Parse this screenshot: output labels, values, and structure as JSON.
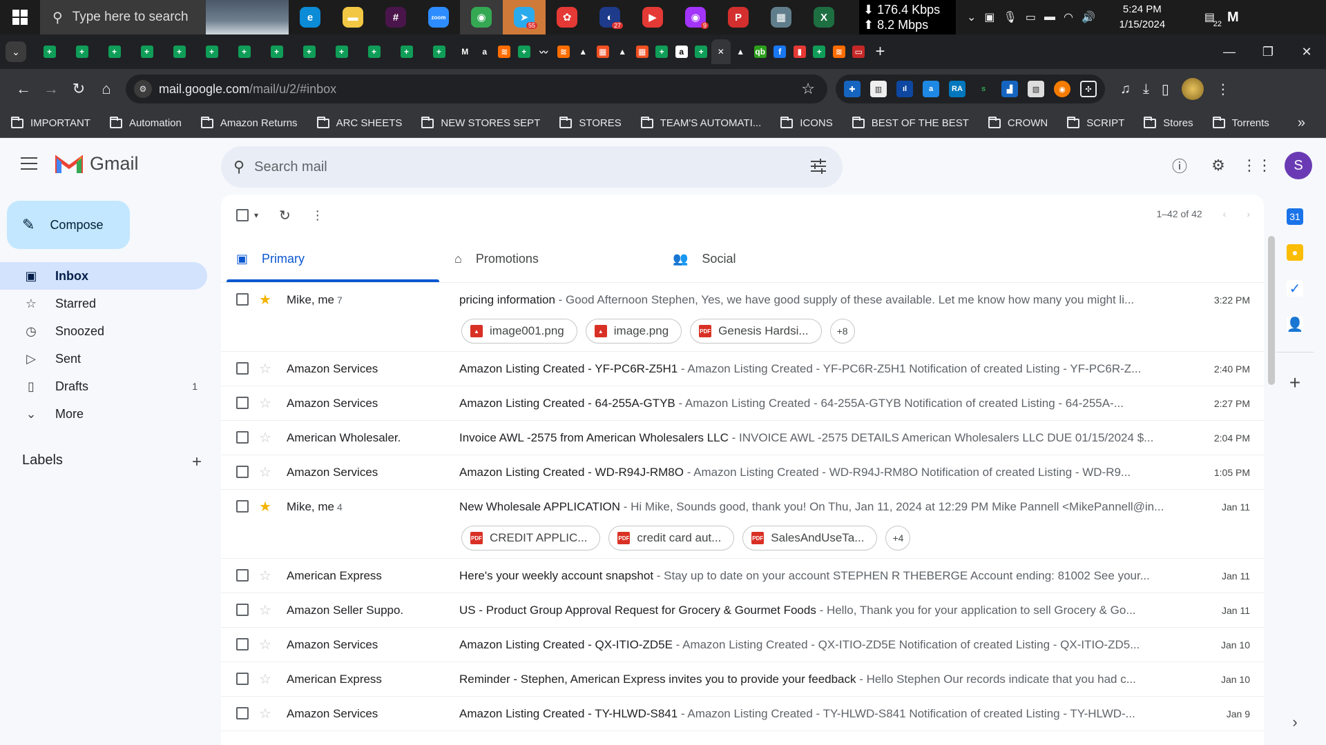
{
  "taskbar": {
    "search_placeholder": "Type here to search",
    "net_down": "⬇ 176.4 Kbps",
    "net_up": "⬆ 8.2 Mbps",
    "time": "5:24 PM",
    "date": "1/15/2024",
    "notif_count": "22",
    "apps": [
      {
        "name": "edge",
        "color": "#0c8bd6",
        "glyph": "e"
      },
      {
        "name": "file-explorer",
        "color": "#f2c744",
        "glyph": "▬"
      },
      {
        "name": "slack",
        "color": "#4a154b",
        "glyph": "#"
      },
      {
        "name": "zoom",
        "color": "#2d8cff",
        "glyph": "zoom"
      },
      {
        "name": "chrome",
        "color": "#34a853",
        "glyph": "◉"
      },
      {
        "name": "telegram",
        "color": "#2aabee",
        "glyph": "➤",
        "badge": "55"
      },
      {
        "name": "app-red",
        "color": "#e53935",
        "glyph": "✿"
      },
      {
        "name": "app-blue",
        "color": "#1e3a8a",
        "glyph": "◐",
        "badge": "27"
      },
      {
        "name": "app-play",
        "color": "#e53935",
        "glyph": "▶"
      },
      {
        "name": "app-messenger",
        "color": "#a334fa",
        "glyph": "◉",
        "badge": "9"
      },
      {
        "name": "app-p",
        "color": "#d32f2f",
        "glyph": "P"
      },
      {
        "name": "calculator",
        "color": "#607d8b",
        "glyph": "▦"
      },
      {
        "name": "excel",
        "color": "#1d6f42",
        "glyph": "X"
      }
    ]
  },
  "browser": {
    "url_host": "mail.google.com",
    "url_path": "/mail/u/2/#inbox",
    "bookmarks": [
      "IMPORTANT",
      "Automation",
      "Amazon Returns",
      "ARC SHEETS",
      "NEW STORES SEPT",
      "STORES",
      "TEAM'S AUTOMATI...",
      "ICONS",
      "BEST OF THE BEST",
      "CROWN",
      "SCRIPT",
      "Stores",
      "Torrents"
    ]
  },
  "gmail": {
    "logo_text": "Gmail",
    "search_placeholder": "Search mail",
    "profile_initial": "S",
    "compose_label": "Compose",
    "nav": [
      {
        "key": "inbox",
        "label": "Inbox",
        "count": ""
      },
      {
        "key": "starred",
        "label": "Starred",
        "count": ""
      },
      {
        "key": "snoozed",
        "label": "Snoozed",
        "count": ""
      },
      {
        "key": "sent",
        "label": "Sent",
        "count": ""
      },
      {
        "key": "drafts",
        "label": "Drafts",
        "count": "1"
      },
      {
        "key": "more",
        "label": "More",
        "count": ""
      }
    ],
    "labels_heading": "Labels",
    "pager_text": "1–42 of 42",
    "tabs": [
      {
        "key": "primary",
        "label": "Primary"
      },
      {
        "key": "promotions",
        "label": "Promotions"
      },
      {
        "key": "social",
        "label": "Social"
      }
    ],
    "emails": [
      {
        "sender": "Mike, me",
        "count": "7",
        "starred": true,
        "subject": "pricing information",
        "snippet": " - Good Afternoon Stephen, Yes, we have good supply of these available. Let me know how many you might li...",
        "date": "3:22 PM",
        "attachments": [
          {
            "name": "image001.png",
            "type": "img"
          },
          {
            "name": "image.png",
            "type": "img"
          },
          {
            "name": "Genesis Hardsi...",
            "type": "pdf"
          }
        ],
        "more": "+8"
      },
      {
        "sender": "Amazon Services",
        "count": "",
        "starred": false,
        "subject": "Amazon Listing Created - YF-PC6R-Z5H1",
        "snippet": " - Amazon Listing Created - YF-PC6R-Z5H1 Notification of created Listing - YF-PC6R-Z...",
        "date": "2:40 PM"
      },
      {
        "sender": "Amazon Services",
        "count": "",
        "starred": false,
        "subject": "Amazon Listing Created - 64-255A-GTYB",
        "snippet": " - Amazon Listing Created - 64-255A-GTYB Notification of created Listing - 64-255A-...",
        "date": "2:27 PM"
      },
      {
        "sender": "American Wholesaler.",
        "count": "",
        "starred": false,
        "subject": "Invoice AWL -2575 from American Wholesalers LLC",
        "snippet": " - INVOICE AWL -2575 DETAILS American Wholesalers LLC DUE 01/15/2024 $...",
        "date": "2:04 PM"
      },
      {
        "sender": "Amazon Services",
        "count": "",
        "starred": false,
        "subject": "Amazon Listing Created - WD-R94J-RM8O",
        "snippet": " - Amazon Listing Created - WD-R94J-RM8O Notification of created Listing - WD-R9...",
        "date": "1:05 PM"
      },
      {
        "sender": "Mike, me",
        "count": "4",
        "starred": true,
        "subject": "New Wholesale APPLICATION",
        "snippet": " - Hi Mike, Sounds good, thank you! On Thu, Jan 11, 2024 at 12:29 PM Mike Pannell <MikePannell@in...",
        "date": "Jan 11",
        "attachments": [
          {
            "name": "CREDIT APPLIC...",
            "type": "pdf"
          },
          {
            "name": "credit card aut...",
            "type": "pdf"
          },
          {
            "name": "SalesAndUseTa...",
            "type": "pdf"
          }
        ],
        "more": "+4"
      },
      {
        "sender": "American Express",
        "count": "",
        "starred": false,
        "subject": "Here's your weekly account snapshot",
        "snippet": " - Stay up to date on your account STEPHEN R THEBERGE Account ending: 81002 See your...",
        "date": "Jan 11"
      },
      {
        "sender": "Amazon Seller Suppo.",
        "count": "",
        "starred": false,
        "subject": "US - Product Group Approval Request for Grocery & Gourmet Foods",
        "snippet": " - Hello, Thank you for your application to sell Grocery & Go...",
        "date": "Jan 11"
      },
      {
        "sender": "Amazon Services",
        "count": "",
        "starred": false,
        "subject": "Amazon Listing Created - QX-ITIO-ZD5E",
        "snippet": " - Amazon Listing Created - QX-ITIO-ZD5E Notification of created Listing - QX-ITIO-ZD5...",
        "date": "Jan 10"
      },
      {
        "sender": "American Express",
        "count": "",
        "starred": false,
        "subject": "Reminder - Stephen, American Express invites you to provide your feedback",
        "snippet": " - Hello Stephen Our records indicate that you had c...",
        "date": "Jan 10"
      },
      {
        "sender": "Amazon Services",
        "count": "",
        "starred": false,
        "subject": "Amazon Listing Created - TY-HLWD-S841",
        "snippet": " - Amazon Listing Created - TY-HLWD-S841 Notification of created Listing - TY-HLWD-...",
        "date": "Jan 9"
      }
    ]
  }
}
